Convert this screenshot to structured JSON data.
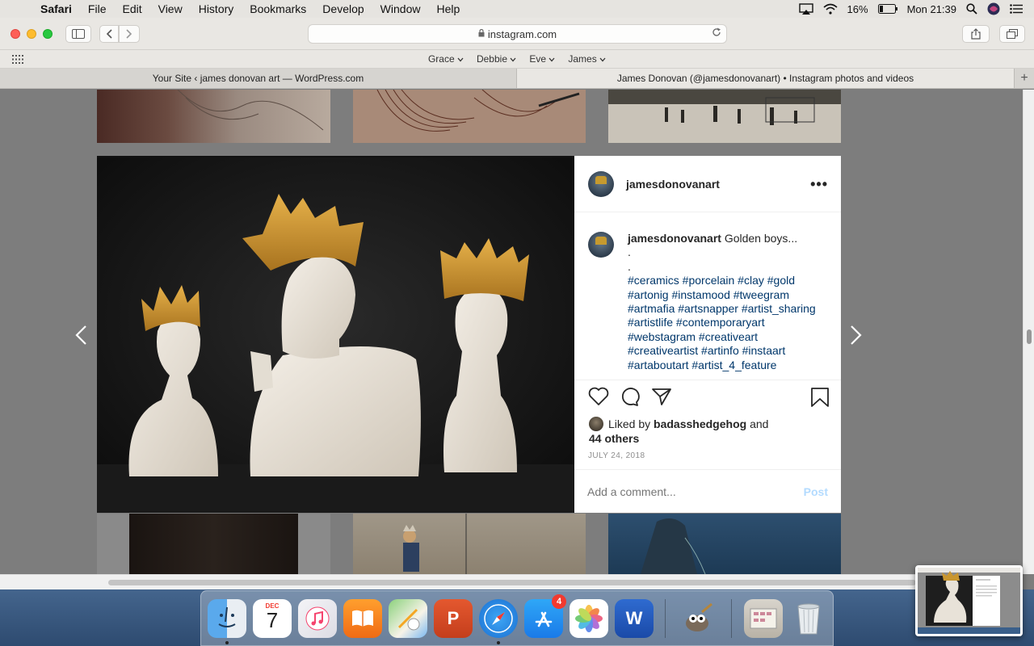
{
  "menubar": {
    "app_name": "Safari",
    "items": [
      "File",
      "Edit",
      "View",
      "History",
      "Bookmarks",
      "Develop",
      "Window",
      "Help"
    ],
    "battery": "16%",
    "clock": "Mon 21:39"
  },
  "browser": {
    "url": "instagram.com",
    "favorites": [
      "Grace",
      "Debbie",
      "Eve",
      "James"
    ],
    "tabs": [
      {
        "title": "Your Site ‹ james donovan art — WordPress.com",
        "active": false
      },
      {
        "title": "James Donovan (@jamesdonovanart) • Instagram photos and videos",
        "active": true
      }
    ],
    "new_tab": "+"
  },
  "post": {
    "username": "jamesdonovanart",
    "caption_user": "jamesdonovanart",
    "caption_text": "Golden boys...",
    "dot1": ".",
    "dot2": ".",
    "hashtags": "#ceramics #porcelain #clay #gold #artonig #instamood #tweegram #artmafia #artsnapper #artist_sharing #artistlife #contemporaryart #webstagram #creativeart #creativeartist #artinfo #instaart #artaboutart #artist_4_feature",
    "liked_by_prefix": "Liked by",
    "liked_by_user": "badasshedgehog",
    "liked_by_and": "and",
    "liked_others": "44 others",
    "date": "JULY 24, 2018",
    "comment_placeholder": "Add a comment...",
    "post_label": "Post"
  },
  "dock": {
    "calendar_month": "DEC",
    "calendar_day": "7",
    "appstore_badge": "4",
    "powerpoint_letter": "P",
    "word_letter": "W"
  },
  "colors": {
    "hashtag": "#00376b",
    "post_button": "#b3dbff",
    "crown_gold": "#c69a2f"
  }
}
